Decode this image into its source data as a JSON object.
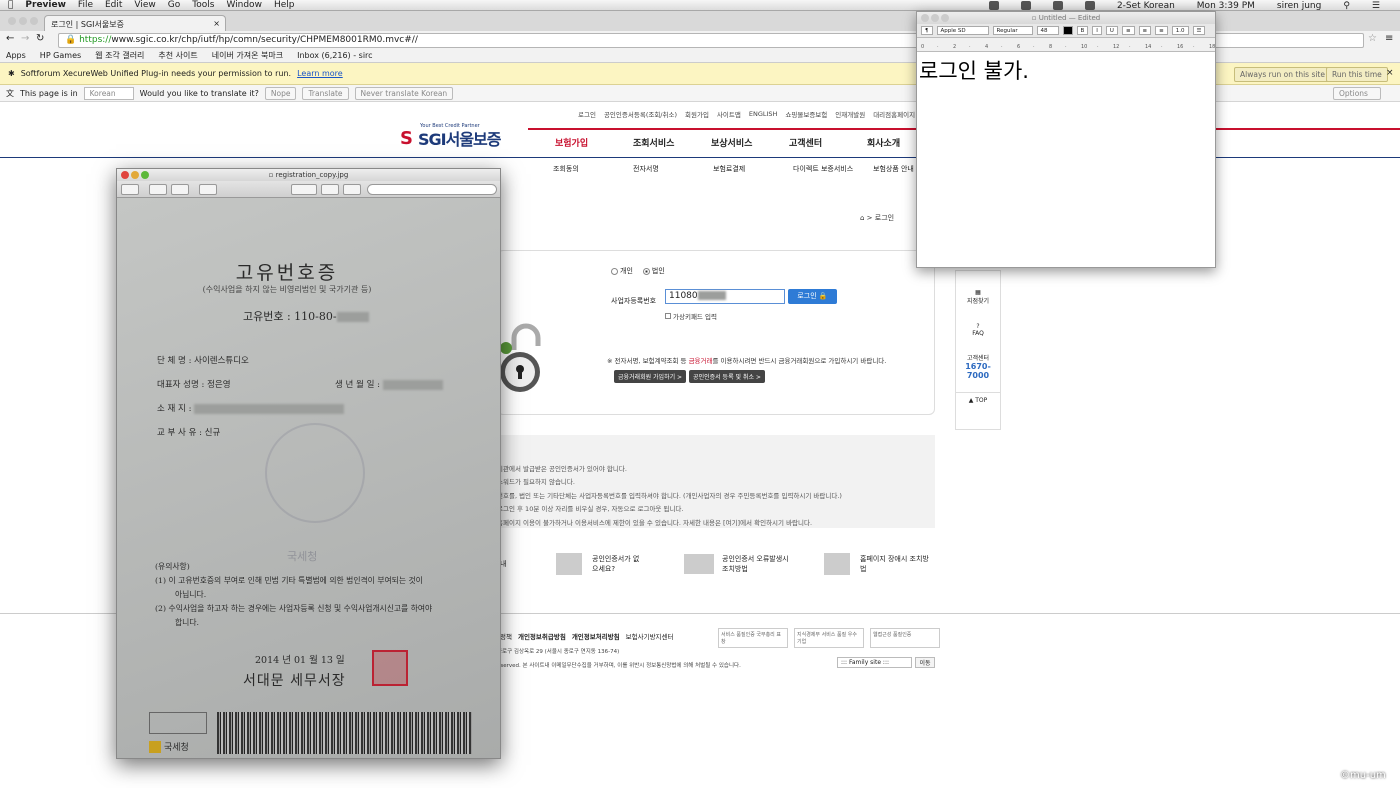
{
  "menubar": {
    "app": "Preview",
    "items": [
      "File",
      "Edit",
      "View",
      "Go",
      "Tools",
      "Window",
      "Help"
    ],
    "input": "2-Set Korean",
    "clock": "Mon 3:39 PM",
    "user": "siren jung"
  },
  "browser": {
    "tab_title": "로그인 | SGI서울보증",
    "url_https": "https://",
    "url_rest": "www.sgic.co.kr/chp/iutf/hp/comn/security/CHPMEM8001RM0.mvc#//",
    "bookmarks": [
      "Apps",
      "HP Games",
      "웹 조각 갤러리",
      "추천 사이트",
      "네이버 가져온 북마크",
      "Inbox (6,216) - sirc"
    ],
    "plugin_msg": "Softforum XecureWeb Unified Plug-in needs your permission to run.",
    "plugin_link": "Learn more",
    "plugin_always": "Always run on this site",
    "plugin_run": "Run this time",
    "tr_label": "This page is in",
    "tr_lang": "Korean",
    "tr_question": "Would you like to translate it?",
    "tr_nope": "Nope",
    "tr_translate": "Translate",
    "tr_never": "Never translate Korean",
    "tr_options": "Options"
  },
  "site": {
    "util": [
      "로그인",
      "공인인증서등록(조회/취소)",
      "회원가입",
      "사이트맵",
      "ENGLISH",
      "쇼핑몰보증보험",
      "인재개발원",
      "대리점홈페이지"
    ],
    "logo_tagline": "Your Best Credit Partner",
    "logo": "SGI서울보증",
    "nav": [
      "보험가입",
      "조회서비스",
      "보상서비스",
      "고객센터",
      "회사소개"
    ],
    "subnav": [
      "조회동의",
      "전자서명",
      "보험료결제",
      "다이렉트 보증서비스",
      "보험상품 안내"
    ],
    "breadcrumb": "⌂ > 로그인",
    "radio_personal": "개인",
    "radio_corp": "법인",
    "biz_label": "사업자등록번호",
    "biz_value": "11080",
    "login_btn": "로그인 🔒",
    "vkbd": "가상키패드 입력",
    "notice_a": "※ 전자서명, 보험계약조회 등 ",
    "notice_red": "금융거래",
    "notice_b": "를 이용하시려면 반드시 금융거래회원으로 가입하시기 바랍니다.",
    "btn_join": "금융거래회원 가입하기 >",
    "btn_cert": "공인인증서 등록 및 취소 >",
    "guide": [
      "기관에서 발급받은 공인인증서가 있어야 합니다.",
      "스워드가 필요하지 않습니다.",
      "번호를, 법인 또는 기타단체는 사업자등록번호를 입력하셔야 합니다. (개인사업자의 경우 주민등록번호를 입력하시기 바랍니다.)",
      "로그인 후 10분 이상 자리를 비우실 경우, 자동으로 로그아웃 됩니다.",
      "홈페이지 이용이 불가하거나 이용서비스에 제한이 있을 수 있습니다. 자세한 내용은 [여기]에서 확인하시기 바랍니다."
    ],
    "quick": [
      "내",
      "공인인증서가 없으세요?",
      "공인인증서 오류발생시 조치방법",
      "홈페이지 장애시 조치방법"
    ],
    "foot_links": [
      "정책",
      "개인정보취급방침",
      "개인정보처리방침",
      "보험사기방지센터"
    ],
    "foot_addr": "종로구 김상옥로 29 (서울시 종로구 연지동 136-74)",
    "foot_copy": "eserved.  본 사이트내 이메일무단수집을 거부하며, 이를 위반시 정보통신망법에 의해 처벌될 수 있습니다.",
    "family": "::: Family site :::",
    "family_go": "이동",
    "badges": [
      "서비스 품질인증 국무총리 표창",
      "지식경제부 서비스 품질 우수기업",
      "웹접근성 품질인증"
    ],
    "side": [
      "지점찾기",
      "FAQ",
      "고객센터",
      "1670-7000",
      "TOP"
    ]
  },
  "textedit": {
    "title": "Untitled",
    "edited": "— Edited",
    "font": "Apple SD Gothi...",
    "style": "Regular",
    "size": "48",
    "spacing": "1.0",
    "text": "로그인 불가."
  },
  "preview": {
    "filename": "registration_copy.jpg",
    "title": "고유번호증",
    "subtitle": "(수익사업을 하지 않는 비영리법인 및 국가기관 등)",
    "number_label": "고유번호 : 110-80-",
    "group_label": "단    체    명 :",
    "group_value": "사이렌스튜디오",
    "rep_label": "대표자 성명 :",
    "rep_value": "정은영",
    "birth_label": "생  년  월  일 :",
    "addr_label": "소      재      지 :",
    "reason_label": "교  부  사  유 :",
    "reason_value": "신규",
    "notes_title": "(유의사항)",
    "note1": "(1) 이 고유번호증의 부여로 인해 민법 기타 특별법에 의한 법인격이 부여되는 것이",
    "note1b": "아닙니다.",
    "note2": "(2) 수익사업을 하고자 하는 경우에는 사업자등록 신청 및 수익사업개시신고를 하여야",
    "note2b": "합니다.",
    "date": "2014 년   01 월   13 일",
    "office": "서대문 세무서장",
    "seal_text": "국세청",
    "nts": "국세청"
  },
  "watermark": "©mu-um"
}
